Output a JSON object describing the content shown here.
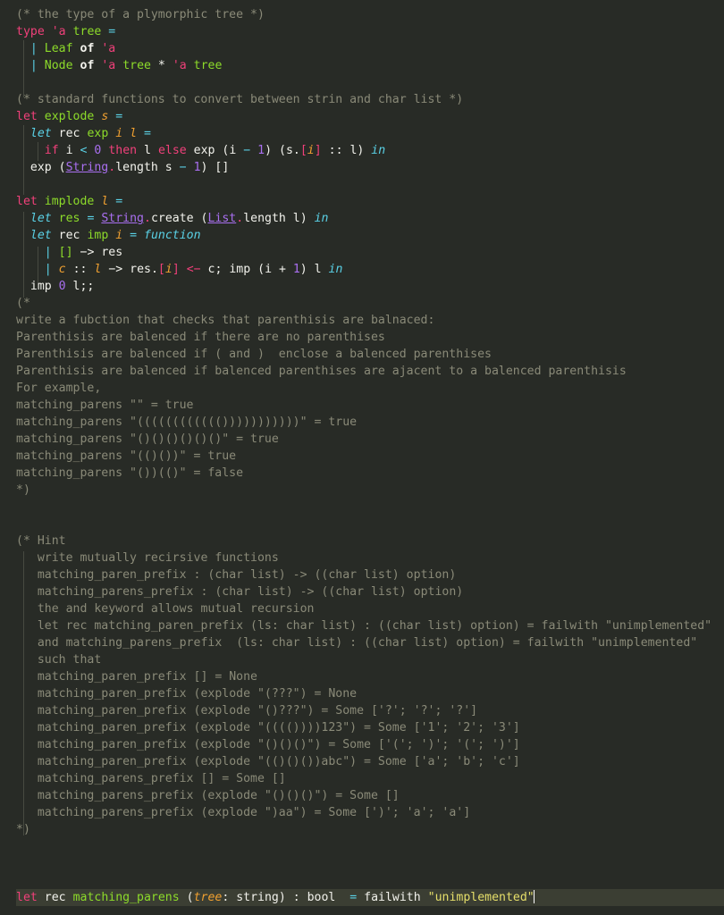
{
  "editor": {
    "language": "OCaml",
    "background": "#282b26",
    "current_line_background": "#3b3e33",
    "default_text_color": "#d8d8d0",
    "comment_color": "#8a8a78",
    "keyword_color": "#f0407a",
    "string_color": "#e6df6a",
    "type_color": "#8ddb2a",
    "operator_color": "#5ad1e6",
    "number_color": "#a96ff0",
    "variable_color": "#f0a030",
    "cursor_color": "#ffffff"
  },
  "lines": {
    "l1_comment": "(* the type of a plymorphic tree *)",
    "l2_type": "type",
    "l2_tyvar": "'a",
    "l2_name": "tree",
    "l2_eq": "=",
    "l3_bar": "|",
    "l3_ctor": "Leaf",
    "l3_of": "of",
    "l3_tyvar": "'a",
    "l4_bar": "|",
    "l4_ctor": "Node",
    "l4_of": "of",
    "l4_tyvar1": "'a",
    "l4_tree1": "tree",
    "l4_star": "*",
    "l4_tyvar2": "'a",
    "l4_tree2": "tree",
    "l6_comment": "(* standard functions to convert between strin and char list *)",
    "l7_let": "let",
    "l7_name": "explode",
    "l7_arg": "s",
    "l7_eq": "=",
    "l8_let": "let",
    "l8_rec": "rec",
    "l8_name": "exp",
    "l8_arg1": "i",
    "l8_arg2": "l",
    "l8_eq": "=",
    "l9_if": "if",
    "l9_i": "i",
    "l9_lt": "<",
    "l9_zero": "0",
    "l9_then": "then",
    "l9_l": "l",
    "l9_else": "else",
    "l9_exp": "exp (i",
    "l9_minus": "−",
    "l9_one": "1",
    "l9_rest": ") (s.",
    "l9_idx_open": "[",
    "l9_idx_i": "i",
    "l9_idx_close": "]",
    "l9_cons": " :: l) ",
    "l9_in": "in",
    "l10_exp": "exp (",
    "l10_String": "String",
    "l10_dot": ".",
    "l10_length": "length s ",
    "l10_minus": "−",
    "l10_one": "1",
    "l10_tail": ") []",
    "l12_let": "let",
    "l12_name": "implode",
    "l12_arg": "l",
    "l12_eq": "=",
    "l13_let": "let",
    "l13_res": "res",
    "l13_eq": "=",
    "l13_String": "String",
    "l13_dot1": ".",
    "l13_create": "create (",
    "l13_List": "List",
    "l13_dot2": ".",
    "l13_length": "length l) ",
    "l13_in": "in",
    "l14_let": "let",
    "l14_rec": "rec",
    "l14_imp": "imp",
    "l14_i": "i",
    "l14_eq": "=",
    "l14_function": "function",
    "l15_bar": "|",
    "l15_nil": "[]",
    "l15_arrow": "−> res",
    "l16_bar": "|",
    "l16_c": "c",
    "l16_cons": "::",
    "l16_l": "l",
    "l16_arrow": "−> res.",
    "l16_idx_open": "[",
    "l16_idx_i": "i",
    "l16_idx_close": "]",
    "l16_assign": "<−",
    "l16_mid": " c; imp (i + ",
    "l16_one": "1",
    "l16_tail": ") l ",
    "l16_in": "in",
    "l17_imp": "imp ",
    "l17_zero": "0",
    "l17_tail": " l;;",
    "c18": "(*",
    "c19": "write a fubction that checks that parenthisis are balnaced:",
    "c20": "Parenthisis are balenced if there are no parenthises",
    "c21": "Parenthisis are balenced if ( and )  enclose a balenced parenthises",
    "c22": "Parenthisis are balenced if balenced parenthises are ajacent to a balenced parenthisis",
    "c23": "For example,",
    "c24": "matching_parens \"\" = true",
    "c25": "matching_parens \"(((((((((((()))))))))))\" = true",
    "c26": "matching_parens \"()()()()()()\" = true",
    "c27": "matching_parens \"(()())\" = true",
    "c28": "matching_parens \"())(()\" = false",
    "c29": "*)",
    "h1": "(* Hint",
    "h2": "write mutually recirsive functions",
    "h3": "matching_paren_prefix : (char list) -> ((char list) option)",
    "h4": "matching_parens_prefix : (char list) -> ((char list) option)",
    "h5": "the and keyword allows mutual recursion",
    "h6": "let rec matching_paren_prefix (ls: char list) : ((char list) option) = failwith \"unimplemented\"",
    "h7": "and matching_parens_prefix  (ls: char list) : ((char list) option) = failwith \"unimplemented\"",
    "h8": "such that",
    "h9": "matching_paren_prefix [] = None",
    "h10": "matching_paren_prefix (explode \"(???\") = None",
    "h11": "matching_paren_prefix (explode \"()???\") = Some ['?'; '?'; '?']",
    "h12": "matching_paren_prefix (explode \"(((())))123\") = Some ['1'; '2'; '3']",
    "h13": "matching_paren_prefix (explode \"()()()\") = Some ['('; ')'; '('; ')']",
    "h14": "matching_paren_prefix (explode \"(()()())abc\") = Some ['a'; 'b'; 'c']",
    "h15": "matching_parens_prefix [] = Some []",
    "h16": "matching_parens_prefix (explode \"()()()\") = Some []",
    "h17": "matching_parens_prefix (explode \")aa\") = Some [')'; 'a'; 'a']",
    "h18": "*)",
    "final_let": "let",
    "final_rec": "rec",
    "final_name": "matching_parens",
    "final_paren_open": "(",
    "final_arg": "tree",
    "final_argtype": ": string) : bool ",
    "final_eq": "=",
    "final_failwith": " failwith ",
    "final_string": "\"unimplemented\""
  }
}
